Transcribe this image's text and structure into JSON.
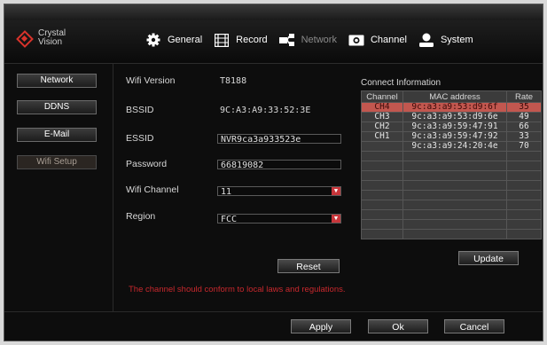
{
  "brand": {
    "line1": "Crystal",
    "line2": "Vision"
  },
  "tabs": [
    {
      "label": "General",
      "icon": "gear-icon"
    },
    {
      "label": "Record",
      "icon": "film-icon"
    },
    {
      "label": "Network",
      "icon": "network-icon"
    },
    {
      "label": "Channel",
      "icon": "camera-icon"
    },
    {
      "label": "System",
      "icon": "user-icon"
    }
  ],
  "sidebar": {
    "items": [
      {
        "label": "Network"
      },
      {
        "label": "DDNS"
      },
      {
        "label": "E-Mail"
      },
      {
        "label": "Wifi Setup"
      }
    ]
  },
  "form": {
    "wifi_version": {
      "label": "Wifi Version",
      "value": "T8188"
    },
    "bssid": {
      "label": "BSSID",
      "value": "9C:A3:A9:33:52:3E"
    },
    "essid": {
      "label": "ESSID",
      "value": "NVR9ca3a933523e"
    },
    "password": {
      "label": "Password",
      "value": "66819082"
    },
    "wifi_channel": {
      "label": "Wifi Channel",
      "value": "11"
    },
    "region": {
      "label": "Region",
      "value": "FCC"
    }
  },
  "reset_label": "Reset",
  "warning": "The channel should conform to local laws and regulations.",
  "connect": {
    "title": "Connect Information",
    "headers": [
      "Channel",
      "MAC address",
      "Rate"
    ],
    "rows": [
      {
        "channel": "CH4",
        "mac": "9c:a3:a9:53:d9:6f",
        "rate": "35"
      },
      {
        "channel": "CH3",
        "mac": "9c:a3:a9:53:d9:6e",
        "rate": "49"
      },
      {
        "channel": "CH2",
        "mac": "9c:a3:a9:59:47:91",
        "rate": "66"
      },
      {
        "channel": "CH1",
        "mac": "9c:a3:a9:59:47:92",
        "rate": "33"
      },
      {
        "channel": "",
        "mac": "9c:a3:a9:24:20:4e",
        "rate": "70"
      }
    ],
    "selected_row": 0
  },
  "update_label": "Update",
  "footer": {
    "apply": "Apply",
    "ok": "Ok",
    "cancel": "Cancel"
  },
  "colors": {
    "accent": "#c7353a",
    "selected_row": "#c2574f",
    "background": "#0d0d0d"
  }
}
